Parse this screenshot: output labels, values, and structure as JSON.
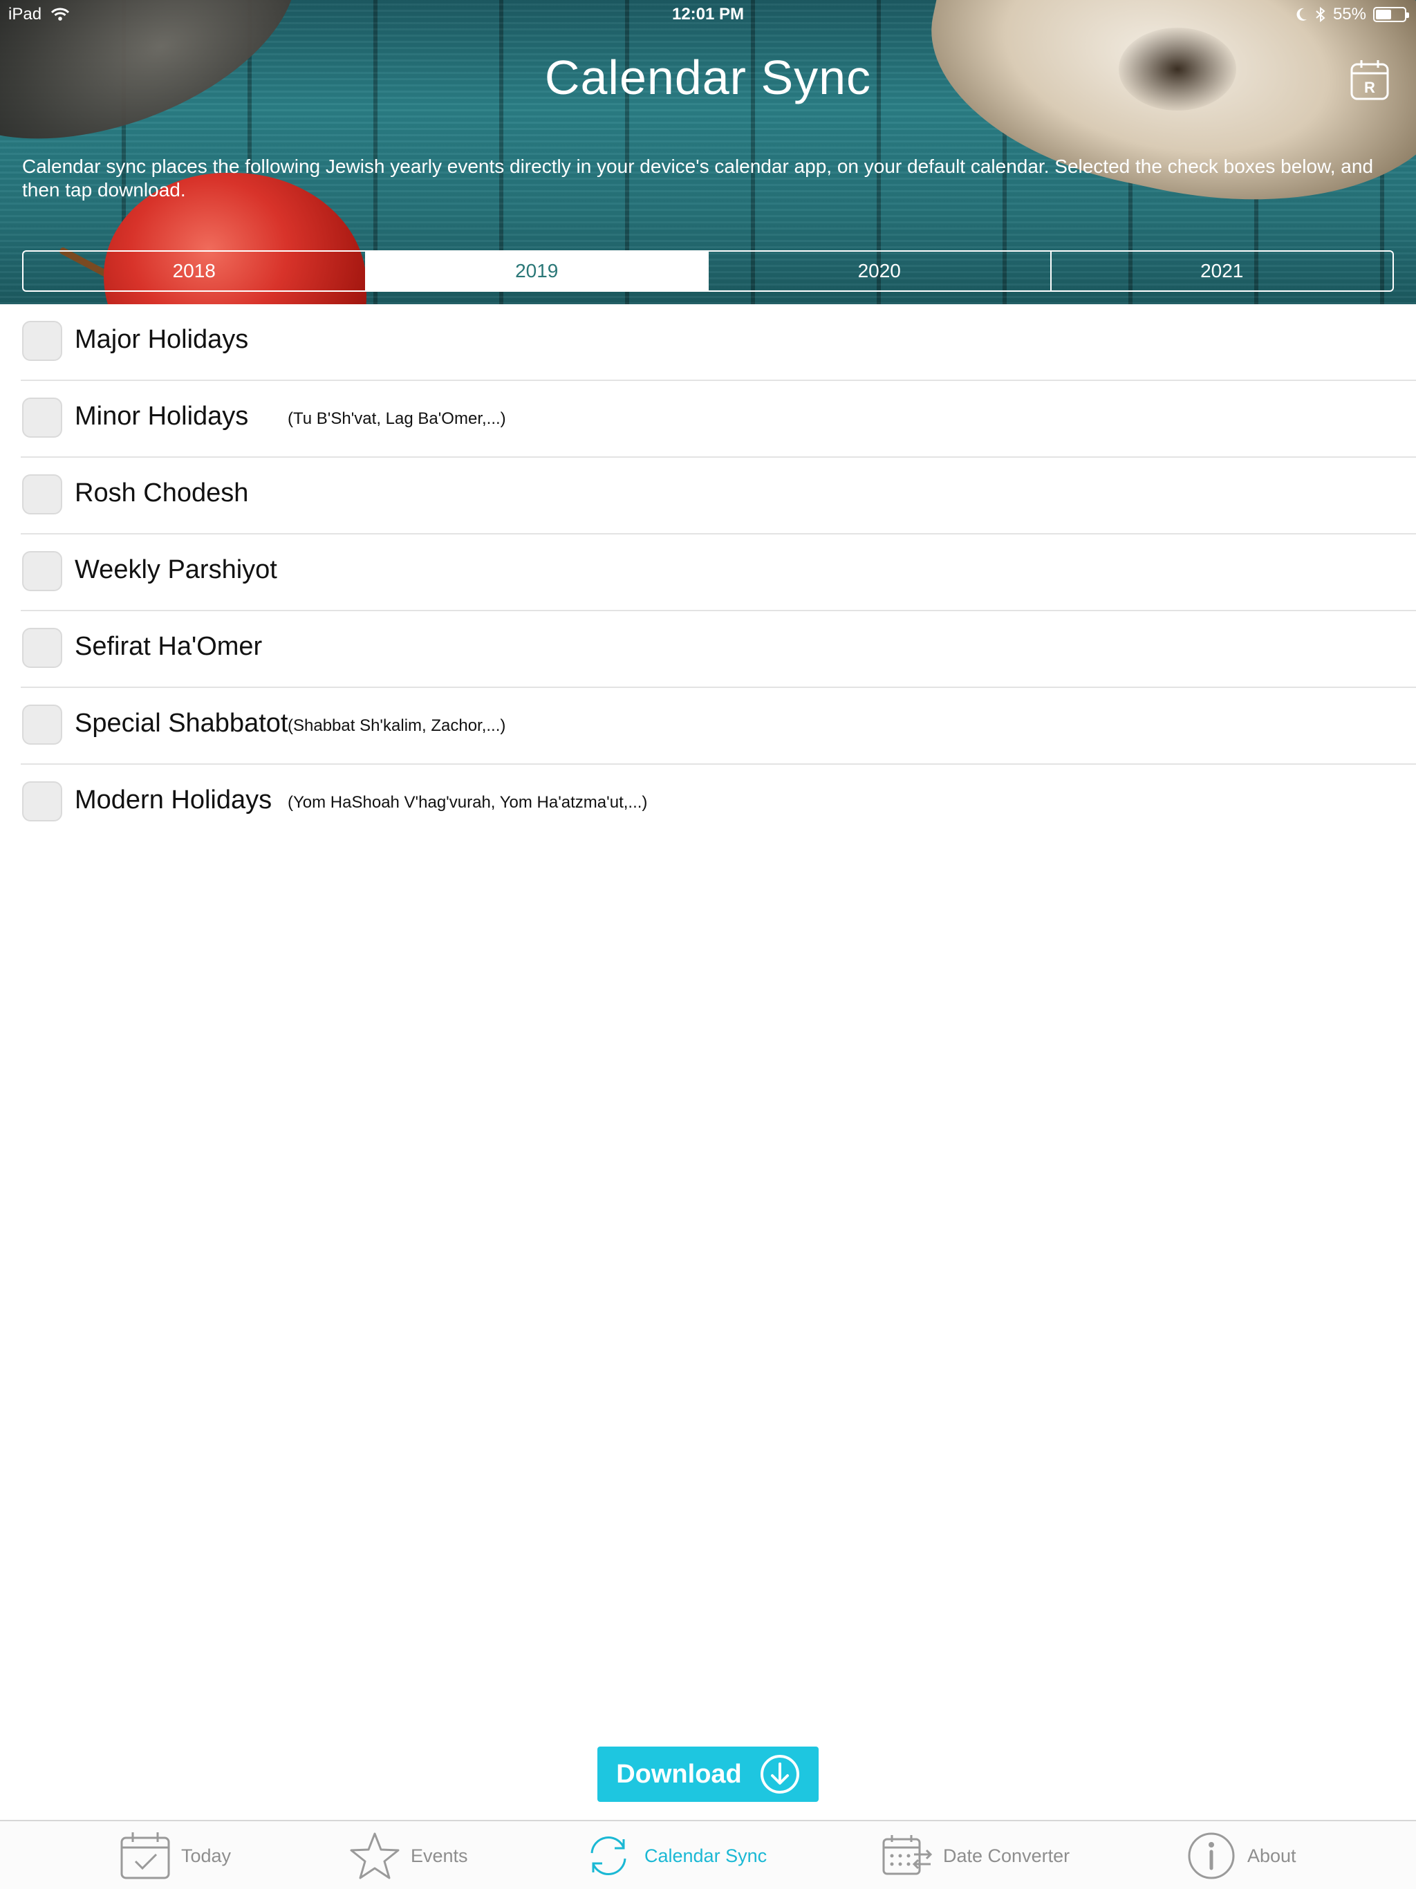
{
  "status_bar": {
    "device": "iPad",
    "time": "12:01 PM",
    "battery": "55%",
    "battery_level": 0.55
  },
  "header": {
    "title": "Calendar Sync",
    "calendar_icon_letter": "R",
    "intro": "Calendar sync places the following Jewish yearly events directly in your device's calendar app, on your default calendar. Selected the check boxes below, and then tap download."
  },
  "years": {
    "items": [
      "2018",
      "2019",
      "2020",
      "2021"
    ],
    "selected": "2019"
  },
  "events": [
    {
      "label": "Major Holidays",
      "note": "",
      "checked": false
    },
    {
      "label": "Minor Holidays",
      "note": "(Tu B'Sh'vat, Lag Ba'Omer,...)",
      "checked": false
    },
    {
      "label": "Rosh Chodesh",
      "note": "",
      "checked": false
    },
    {
      "label": "Weekly Parshiyot",
      "note": "",
      "checked": false
    },
    {
      "label": "Sefirat Ha'Omer",
      "note": "",
      "checked": false
    },
    {
      "label": "Special Shabbatot",
      "note": "(Shabbat Sh'kalim, Zachor,...)",
      "checked": false
    },
    {
      "label": "Modern Holidays",
      "note": "(Yom HaShoah V'hag'vurah, Yom Ha'atzma'ut,...)",
      "checked": false
    }
  ],
  "download": {
    "label": "Download"
  },
  "tabs": [
    {
      "label": "Today",
      "icon": "calendar-check-icon"
    },
    {
      "label": "Events",
      "icon": "star-icon"
    },
    {
      "label": "Calendar Sync",
      "icon": "sync-icon",
      "active": true
    },
    {
      "label": "Date Converter",
      "icon": "date-converter-icon"
    },
    {
      "label": "About",
      "icon": "info-icon"
    }
  ],
  "colors": {
    "accent": "#1ec6e0",
    "active_tab": "#1ab8d4",
    "selected_year_text": "#2a7777",
    "header_teal": "#2b7f86"
  }
}
